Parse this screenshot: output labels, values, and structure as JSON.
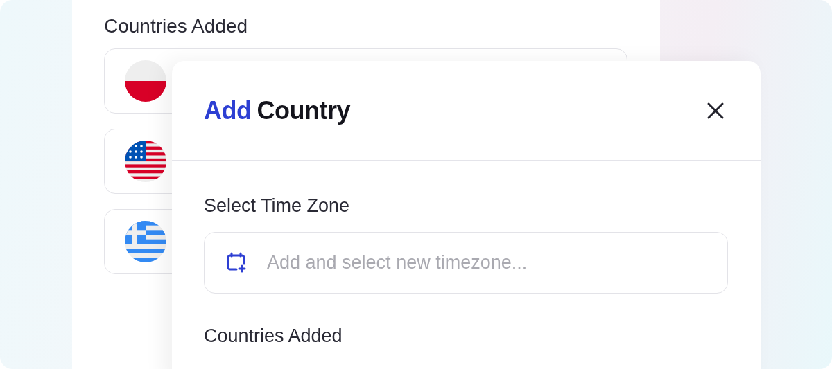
{
  "background_panel": {
    "heading": "Countries Added",
    "countries": [
      {
        "kind": "poland"
      },
      {
        "kind": "usa"
      },
      {
        "kind": "greece"
      }
    ]
  },
  "dialog": {
    "title_accent": "Add",
    "title": "Country",
    "timezone_label": "Select Time Zone",
    "timezone_field": {
      "placeholder": "Add and select new timezone..."
    },
    "countries_label": "Countries Added"
  }
}
